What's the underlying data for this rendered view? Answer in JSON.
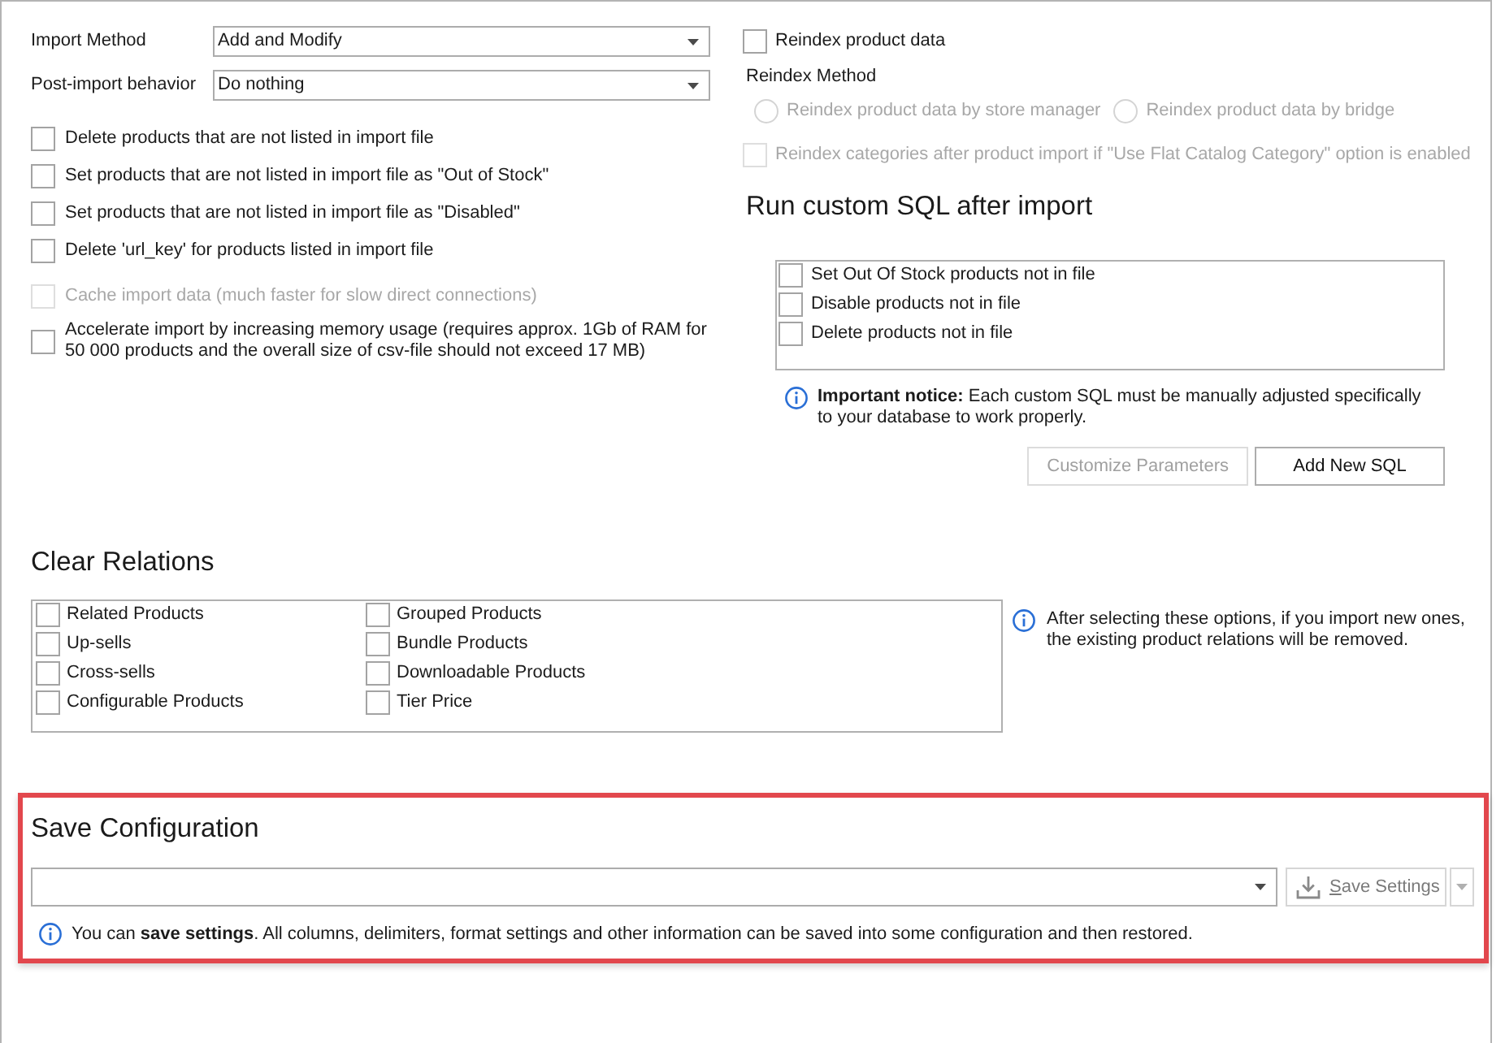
{
  "import_options": {
    "fields": [
      {
        "label": "Import Method",
        "value": "Add and Modify"
      },
      {
        "label": "Post-import behavior",
        "value": "Do nothing"
      }
    ],
    "options": [
      {
        "label": "Delete products that are not listed in import file",
        "checked": false
      },
      {
        "label": "Set products that are not listed in import file as \"Out of Stock\"",
        "checked": false
      },
      {
        "label": "Set products that are not listed in import file as \"Disabled\"",
        "checked": false
      },
      {
        "label": "Delete 'url_key' for products listed in import file",
        "checked": false
      }
    ],
    "performance_options": [
      {
        "label": "Cache import data (much faster for slow direct connections)",
        "checked": false,
        "disabled": true
      },
      {
        "label": "Accelerate import by increasing memory usage (requires approx. 1Gb of RAM for 50 000 products and the overall size of csv-file should not exceed 17 MB)",
        "checked": false,
        "disabled": false
      }
    ]
  },
  "reindex": {
    "option": {
      "label": "Reindex product data",
      "checked": false
    },
    "method_label": "Reindex Method",
    "methods": [
      {
        "label": "Reindex product data by store manager",
        "selected": false,
        "disabled": true
      },
      {
        "label": "Reindex product data by bridge",
        "selected": false,
        "disabled": true
      }
    ],
    "categories_option": {
      "label": "Reindex categories after product import if \"Use Flat Catalog Category\" option is enabled",
      "checked": false,
      "disabled": true
    }
  },
  "custom_sql": {
    "title": "Run custom SQL after import",
    "items": [
      {
        "label": "Set Out Of Stock products not in file",
        "checked": false
      },
      {
        "label": "Disable products not in file",
        "checked": false
      },
      {
        "label": "Delete products not in file",
        "checked": false
      }
    ],
    "notice": "**Important notice:** Each custom SQL must be manually adjusted specifically to your database to work properly.",
    "buttons": [
      {
        "label": "Customize Parameters",
        "disabled": true
      },
      {
        "label": "Add New SQL",
        "disabled": false
      }
    ]
  },
  "clear_relations": {
    "title": "Clear Relations",
    "items": [
      {
        "label": "Related Products",
        "checked": false
      },
      {
        "label": "Up-sells",
        "checked": false
      },
      {
        "label": "Cross-sells",
        "checked": false
      },
      {
        "label": "Configurable Products",
        "checked": false
      },
      {
        "label": "Grouped Products",
        "checked": false
      },
      {
        "label": "Bundle Products",
        "checked": false
      },
      {
        "label": "Downloadable Products",
        "checked": false
      },
      {
        "label": "Tier Price",
        "checked": false
      }
    ],
    "notice": "After selecting these options, if you import new ones, the existing product relations will be removed."
  },
  "save_configuration": {
    "title": "Save Configuration",
    "highlighted": true,
    "button": {
      "label": "Save Settings",
      "disabled": true
    },
    "notice": "You can **save settings**. All columns, delimiters, format settings and other information can be saved into some configuration and then restored."
  }
}
